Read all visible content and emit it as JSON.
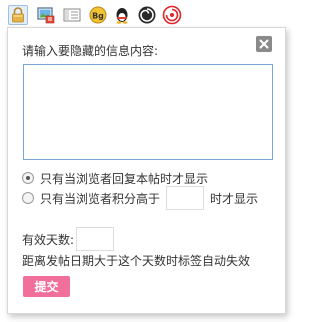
{
  "toolbar": {
    "icons": [
      {
        "name": "lock-icon",
        "active": true
      },
      {
        "name": "image-monitor-icon",
        "active": false
      },
      {
        "name": "list-panel-icon",
        "active": false
      },
      {
        "name": "bg-icon",
        "label": "Bg",
        "active": false
      },
      {
        "name": "qq-penguin-icon",
        "active": false
      },
      {
        "name": "spiral-music-icon",
        "active": false
      },
      {
        "name": "weibo-icon",
        "active": false
      }
    ]
  },
  "popup": {
    "close_symbol": "✕",
    "prompt_label": "请输入要隐藏的信息内容:",
    "textarea_value": "",
    "options": [
      {
        "label": "只有当浏览者回复本帖时才显示",
        "checked": true
      },
      {
        "label_before": "只有当浏览者积分高于",
        "label_after": "时才显示",
        "checked": false,
        "score_value": ""
      }
    ],
    "days_label": "有效天数:",
    "days_value": "",
    "note": "距离发帖日期大于这个天数时标签自动失效",
    "submit_label": "提交"
  },
  "colors": {
    "submit_bg": "#f06f9b",
    "textarea_border": "#7aa6d6",
    "close_bg": "#8a8a8a",
    "lock_gold": "#d9a53a",
    "qq_red": "#e23a2a",
    "weibo_red": "#e0262b"
  }
}
